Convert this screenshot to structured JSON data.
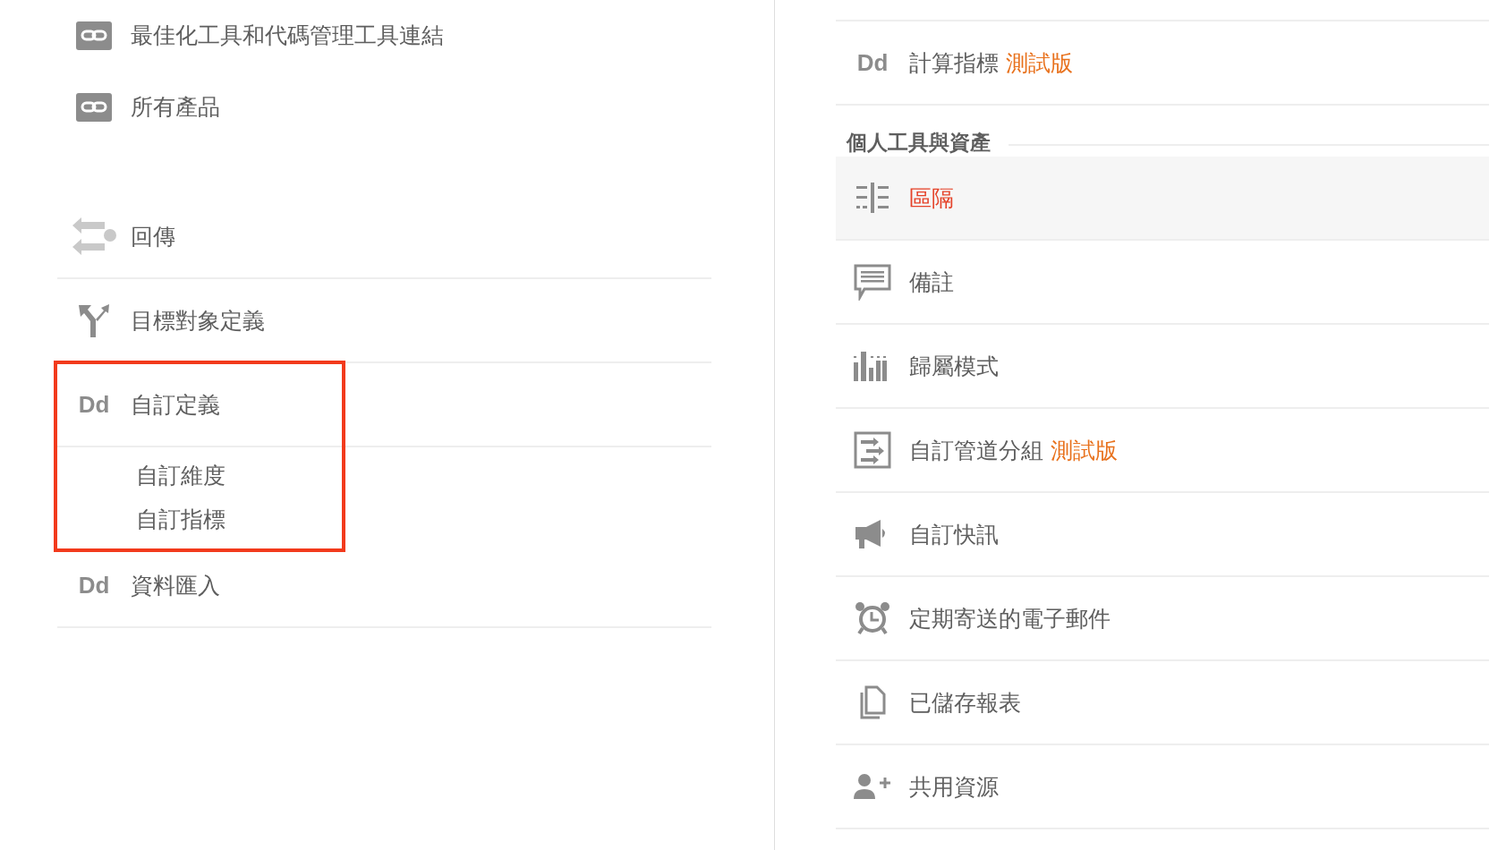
{
  "left_panel": {
    "groups": [
      {
        "items": [
          {
            "kind": "link",
            "label": "最佳化工具和代碼管理工具連結",
            "highlighted": false
          },
          {
            "kind": "link",
            "label": "所有產品",
            "highlighted": false
          }
        ]
      },
      {
        "items": [
          {
            "kind": "swap",
            "label": "回傳",
            "highlighted": false
          },
          {
            "kind": "fork",
            "label": "目標對象定義",
            "highlighted": false
          },
          {
            "kind": "dd",
            "icon_text": "Dd",
            "label": "自訂定義",
            "highlighted": true,
            "children": [
              {
                "label": "自訂維度"
              },
              {
                "label": "自訂指標"
              }
            ]
          },
          {
            "kind": "dd",
            "icon_text": "Dd",
            "label": "資料匯入",
            "highlighted": false
          }
        ]
      }
    ]
  },
  "right_panel": {
    "items": [
      {
        "kind": "dd",
        "icon_text": "Dd",
        "label": "計算指標",
        "badge": "測試版",
        "selected": false
      }
    ],
    "section": {
      "title": "個人工具與資產",
      "items": [
        {
          "kind": "segments",
          "label": "區隔",
          "selected": true
        },
        {
          "kind": "comment",
          "label": "備註",
          "selected": false
        },
        {
          "kind": "bars",
          "label": "歸屬模式",
          "selected": false
        },
        {
          "kind": "channels",
          "label": "自訂管道分組",
          "badge": "測試版",
          "selected": false
        },
        {
          "kind": "megaphone",
          "label": "自訂快訊",
          "selected": false
        },
        {
          "kind": "alarm",
          "label": "定期寄送的電子郵件",
          "selected": false
        },
        {
          "kind": "pages",
          "label": "已儲存報表",
          "selected": false
        },
        {
          "kind": "person",
          "label": "共用資源",
          "selected": false
        }
      ]
    }
  }
}
